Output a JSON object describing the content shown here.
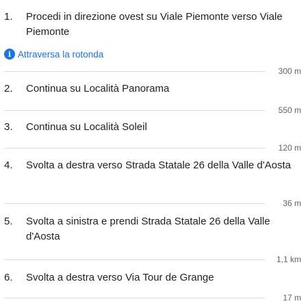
{
  "steps": [
    {
      "number": "1.",
      "text": "Procedi in direzione ovest su Viale Piemonte verso Viale Piemonte",
      "note": "Attraversa la rotonda",
      "distance": "300 m"
    },
    {
      "number": "2.",
      "text": "Continua su Località Panorama",
      "distance": "550 m"
    },
    {
      "number": "3.",
      "text": "Continua su Località Soleil",
      "distance": "120 m"
    },
    {
      "number": "4.",
      "text": "Svolta a destra verso Strada Statale 26 della Valle d'Aosta",
      "distance": "36 m"
    },
    {
      "number": "5.",
      "text": "Svolta a sinistra e prendi Strada Statale 26 della Valle d'Aosta",
      "distance": "1,1 km"
    },
    {
      "number": "6.",
      "text": "Svolta a destra verso Via Tour de Grange",
      "distance": "17 m"
    }
  ],
  "icons": {
    "note_icon": "info-icon"
  },
  "colors": {
    "note": "#1a73e8",
    "distance": "#5f6368",
    "divider": "#dadce0"
  }
}
